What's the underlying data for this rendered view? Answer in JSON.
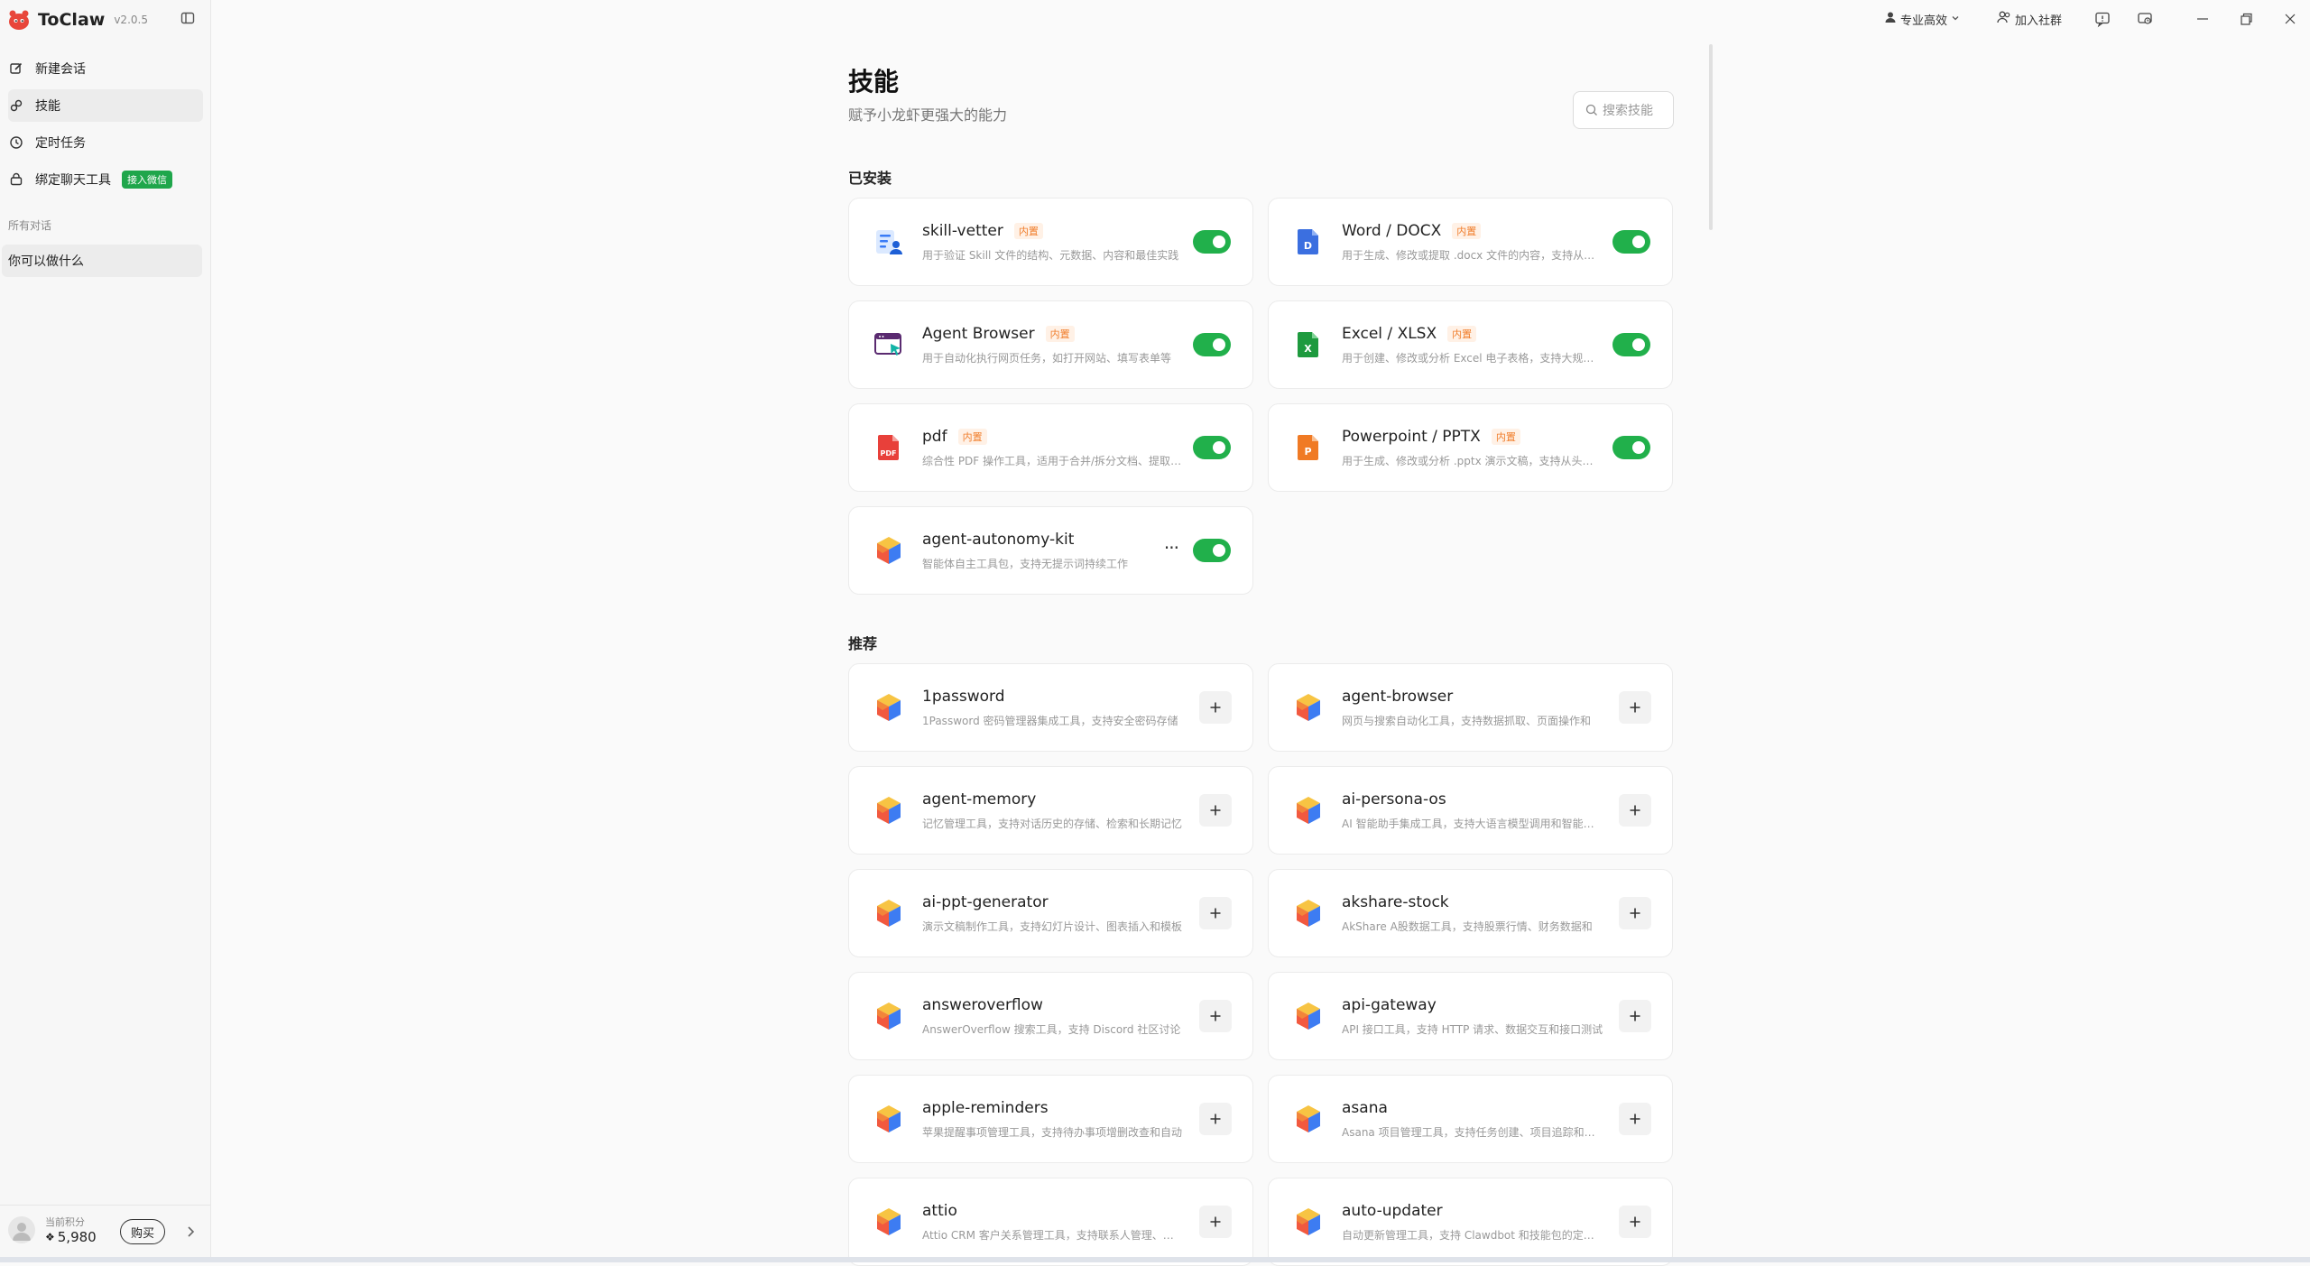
{
  "app": {
    "name": "ToClaw",
    "version": "v2.0.5"
  },
  "sidebar": {
    "nav": [
      {
        "label": "新建会话",
        "icon": "edit-icon"
      },
      {
        "label": "技能",
        "icon": "skills-icon"
      },
      {
        "label": "定时任务",
        "icon": "clock-icon"
      },
      {
        "label": "绑定聊天工具",
        "icon": "bind-tool-icon",
        "badge": "接入微信"
      }
    ],
    "section_label": "所有对话",
    "conversations": [
      "你可以做什么"
    ],
    "footer": {
      "points_label": "当前积分",
      "points": "5,980",
      "buy": "购买"
    }
  },
  "titlebar": {
    "mode": "专业高效",
    "join": "加入社群"
  },
  "page": {
    "title": "技能",
    "subtitle": "赋予小龙虾更强大的能力",
    "search_placeholder": "搜索技能"
  },
  "installed": {
    "title": "已安装",
    "items": [
      {
        "name": "skill-vetter",
        "tag": "内置",
        "desc": "用于验证 Skill 文件的结构、元数据、内容和最佳实践",
        "icon": "skill-vetter-icon"
      },
      {
        "name": "Word / DOCX",
        "tag": "内置",
        "desc": "用于生成、修改或提取 .docx 文件的内容，支持从头创建",
        "icon": "word-icon"
      },
      {
        "name": "Agent Browser",
        "tag": "内置",
        "desc": "用于自动化执行网页任务，如打开网站、填写表单等",
        "icon": "browser-icon"
      },
      {
        "name": "Excel / XLSX",
        "tag": "内置",
        "desc": "用于创建、修改或分析 Excel 电子表格，支持大规模数据",
        "icon": "excel-icon"
      },
      {
        "name": "pdf",
        "tag": "内置",
        "desc": "综合性 PDF 操作工具，适用于合并/拆分文档、提取内容",
        "icon": "pdf-icon"
      },
      {
        "name": "Powerpoint / PPTX",
        "tag": "内置",
        "desc": "用于生成、修改或分析 .pptx 演示文稿，支持从头构建",
        "icon": "ppt-icon"
      },
      {
        "name": "agent-autonomy-kit",
        "tag": "",
        "desc": "智能体自主工具包，支持无提示词持续工作",
        "icon": "cube-icon",
        "more": "···"
      }
    ]
  },
  "recommended": {
    "title": "推荐",
    "items": [
      {
        "name": "1password",
        "desc": "1Password 密码管理器集成工具，支持安全密码存储"
      },
      {
        "name": "agent-browser",
        "desc": "网页与搜索自动化工具，支持数据抓取、页面操作和"
      },
      {
        "name": "agent-memory",
        "desc": "记忆管理工具，支持对话历史的存储、检索和长期记忆"
      },
      {
        "name": "ai-persona-os",
        "desc": "AI 智能助手集成工具，支持大语言模型调用和智能对话"
      },
      {
        "name": "ai-ppt-generator",
        "desc": "演示文稿制作工具，支持幻灯片设计、图表插入和模板"
      },
      {
        "name": "akshare-stock",
        "desc": "AkShare A股数据工具，支持股票行情、财务数据和"
      },
      {
        "name": "answeroverflow",
        "desc": "AnswerOverflow 搜索工具，支持 Discord 社区讨论"
      },
      {
        "name": "api-gateway",
        "desc": "API 接口工具，支持 HTTP 请求、数据交互和接口测试"
      },
      {
        "name": "apple-reminders",
        "desc": "苹果提醒事项管理工具，支持待办事项增删改查和自动"
      },
      {
        "name": "asana",
        "desc": "Asana 项目管理工具，支持任务创建、项目追踪和团队"
      },
      {
        "name": "attio",
        "desc": "Attio CRM 客户关系管理工具，支持联系人管理、销售"
      },
      {
        "name": "auto-updater",
        "desc": "自动更新管理工具，支持 Clawdbot 和技能包的定时更新"
      }
    ]
  }
}
